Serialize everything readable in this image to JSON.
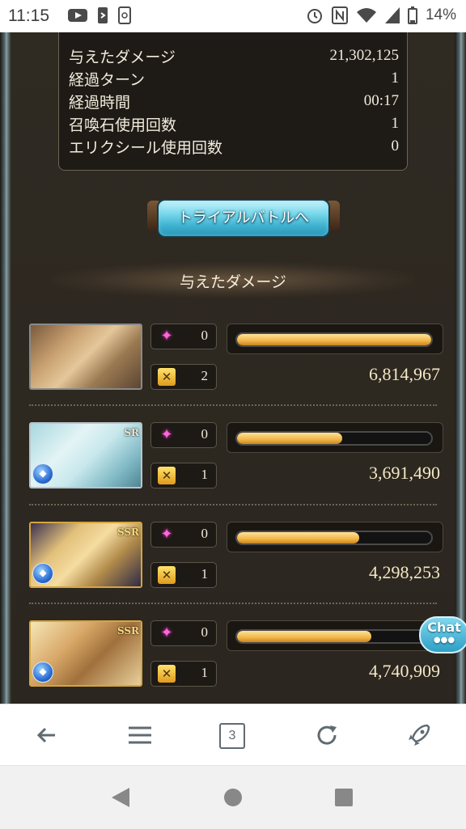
{
  "status_bar": {
    "time": "11:15",
    "battery_percent": "14%",
    "left_icons": [
      "youtube-icon",
      "phone-icon",
      "screenshot-icon"
    ],
    "right_icons": [
      "alarm-icon",
      "nfc-icon",
      "wifi-icon",
      "signal-icon",
      "battery-icon"
    ]
  },
  "summary": {
    "rows": [
      {
        "label": "与えたダメージ",
        "value": "21,302,125"
      },
      {
        "label": "経過ターン",
        "value": "1"
      },
      {
        "label": "経過時間",
        "value": "00:17"
      },
      {
        "label": "召喚石使用回数",
        "value": "1"
      },
      {
        "label": "エリクシール使用回数",
        "value": "0"
      }
    ]
  },
  "trial_button": {
    "label": "トライアルバトルへ"
  },
  "section_title": "与えたダメージ",
  "characters": [
    {
      "pink_count": "0",
      "gold_count": "2",
      "damage": "6,814,967",
      "bar_level": 1.0,
      "rarity": "",
      "element": ""
    },
    {
      "pink_count": "0",
      "gold_count": "1",
      "damage": "3,691,490",
      "bar_level": 0.54,
      "rarity": "SR",
      "element": "water"
    },
    {
      "pink_count": "0",
      "gold_count": "1",
      "damage": "4,298,253",
      "bar_level": 0.63,
      "rarity": "SSR",
      "element": "water"
    },
    {
      "pink_count": "0",
      "gold_count": "1",
      "damage": "4,740,909",
      "bar_level": 0.69,
      "rarity": "SSR",
      "element": "water"
    }
  ],
  "chat_button": {
    "label": "Chat"
  },
  "browser_toolbar": {
    "tab_count": "3",
    "icons": [
      "back-arrow-icon",
      "menu-icon",
      "tabs-icon",
      "refresh-icon",
      "rocket-icon"
    ]
  },
  "colors": {
    "bar_fill": "#f0b546",
    "panel_bg": "#2c2720",
    "button_accent": "#3fb3d1"
  }
}
